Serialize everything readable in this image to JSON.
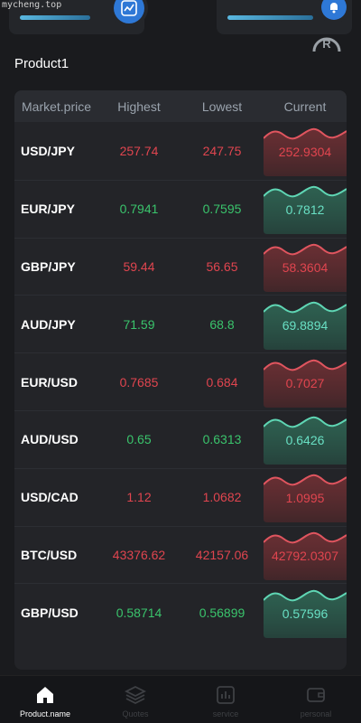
{
  "watermark": "mycheng.top",
  "section_title": "Product1",
  "colors": {
    "up": "#3ac46c",
    "down": "#e0454f",
    "accent": "#2e78d6"
  },
  "table": {
    "headers": [
      "Market.price",
      "Highest",
      "Lowest",
      "Current"
    ],
    "rows": [
      {
        "pair": "USD/JPY",
        "highest": "257.74",
        "lowest": "247.75",
        "current": "252.9304",
        "trend": "down"
      },
      {
        "pair": "EUR/JPY",
        "highest": "0.7941",
        "lowest": "0.7595",
        "current": "0.7812",
        "trend": "up"
      },
      {
        "pair": "GBP/JPY",
        "highest": "59.44",
        "lowest": "56.65",
        "current": "58.3604",
        "trend": "down"
      },
      {
        "pair": "AUD/JPY",
        "highest": "71.59",
        "lowest": "68.8",
        "current": "69.8894",
        "trend": "up"
      },
      {
        "pair": "EUR/USD",
        "highest": "0.7685",
        "lowest": "0.684",
        "current": "0.7027",
        "trend": "down"
      },
      {
        "pair": "AUD/USD",
        "highest": "0.65",
        "lowest": "0.6313",
        "current": "0.6426",
        "trend": "up"
      },
      {
        "pair": "USD/CAD",
        "highest": "1.12",
        "lowest": "1.0682",
        "current": "1.0995",
        "trend": "down"
      },
      {
        "pair": "BTC/USD",
        "highest": "43376.62",
        "lowest": "42157.06",
        "current": "42792.0307",
        "trend": "down"
      },
      {
        "pair": "GBP/USD",
        "highest": "0.58714",
        "lowest": "0.56899",
        "current": "0.57596",
        "trend": "up"
      }
    ]
  },
  "nav": [
    {
      "label": "Product.name",
      "icon": "home-icon",
      "active": true
    },
    {
      "label": "Quotes",
      "icon": "layers-icon",
      "active": false
    },
    {
      "label": "service",
      "icon": "chart-icon",
      "active": false
    },
    {
      "label": "personal",
      "icon": "wallet-icon",
      "active": false
    }
  ]
}
